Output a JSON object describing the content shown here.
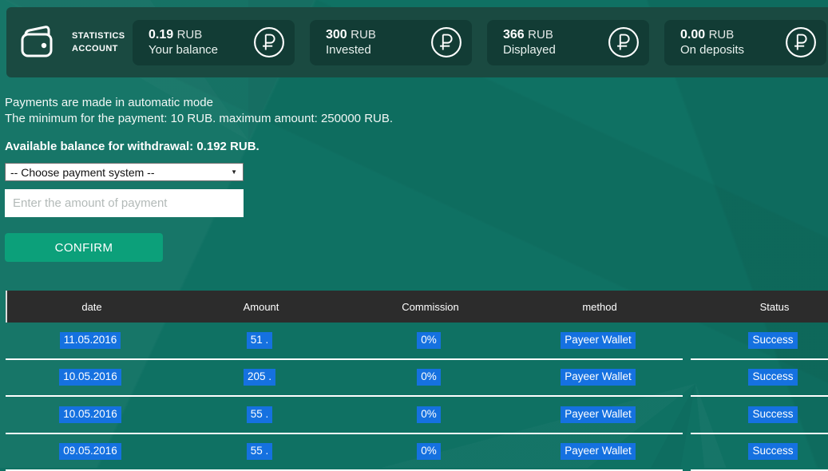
{
  "stats_bar": {
    "title_line1": "STATISTICS",
    "title_line2": "ACCOUNT",
    "cards": [
      {
        "value": "0.19",
        "currency": "RUB",
        "label": "Your balance"
      },
      {
        "value": "300",
        "currency": "RUB",
        "label": "Invested"
      },
      {
        "value": "366",
        "currency": "RUB",
        "label": "Displayed"
      },
      {
        "value": "0.00",
        "currency": "RUB",
        "label": "On deposits"
      }
    ]
  },
  "info": {
    "line1": "Payments are made in automatic mode",
    "line2": "The minimum for the payment: 10 RUB. maximum amount: 250000 RUB.",
    "available": "Available balance for withdrawal: 0.192 RUB."
  },
  "form": {
    "payment_system_selected": "-- Choose payment system --",
    "amount_placeholder": "Enter the amount of payment",
    "confirm_label": "CONFIRM"
  },
  "table": {
    "headers": [
      "date",
      "Amount",
      "Commission",
      "method",
      "Status"
    ],
    "rows": [
      {
        "date": "11.05.2016",
        "amount": "51 .",
        "commission": "0%",
        "method": "Payeer Wallet",
        "status": "Success"
      },
      {
        "date": "10.05.2016",
        "amount": "205 .",
        "commission": "0%",
        "method": "Payeer Wallet",
        "status": "Success"
      },
      {
        "date": "10.05.2016",
        "amount": "55 .",
        "commission": "0%",
        "method": "Payeer Wallet",
        "status": "Success"
      },
      {
        "date": "09.05.2016",
        "amount": "55 .",
        "commission": "0%",
        "method": "Payeer Wallet",
        "status": "Success"
      }
    ]
  },
  "colors": {
    "page_background": "#0F7163",
    "topbar_background": "#1A4A41",
    "card_background": "#123C35",
    "table_header_background": "#2C2C2C",
    "selection_blue": "#1571E0",
    "confirm_green": "#0CA07A"
  }
}
